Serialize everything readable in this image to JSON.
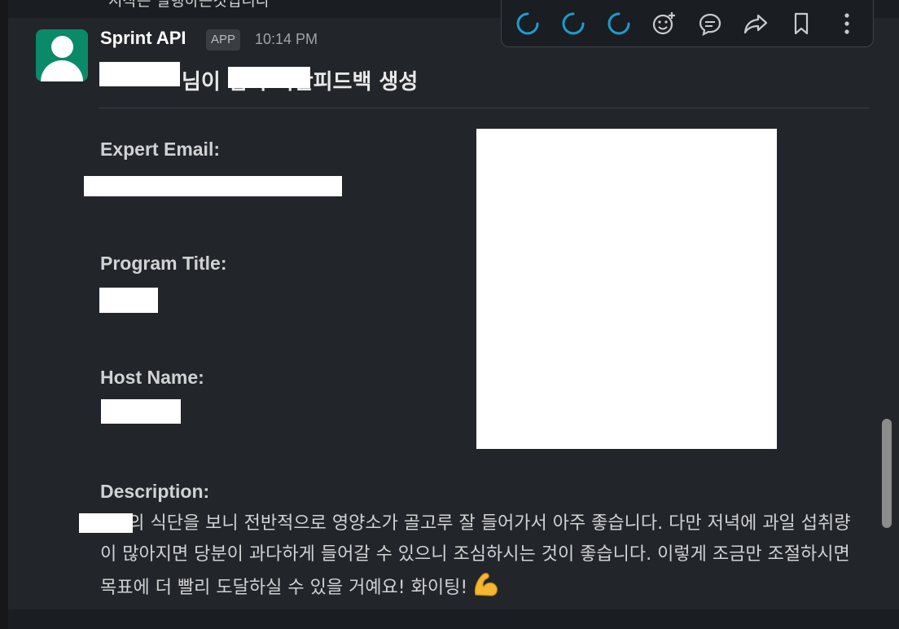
{
  "previous_message": {
    "text": "시작은 실행하는것입니다 ^^"
  },
  "message": {
    "sender": "Sprint API",
    "badge": "APP",
    "time": "10:14 PM",
    "headline": "님이 님의 식단피드백 생성",
    "fields": [
      {
        "label": "Expert Email:",
        "value": ""
      },
      {
        "label": "Program Title:",
        "value": ""
      },
      {
        "label": "Host Name:",
        "value": ""
      },
      {
        "label": "Description:",
        "value": ""
      }
    ],
    "description": "님의 식단을 보니 전반적으로 영양소가 골고루 잘 들어가서 아주 좋습니다. 다만 저녁에 과일 섭취량이 많아지면 당분이 과다하게 들어갈 수 있으니 조심하시는 것이 좋습니다. 이렇게 조금만 조절하시면 목표에 더 빨리 도달하실 수 있을 거예요! 화이팅!",
    "emoji": "flexed-biceps-icon"
  },
  "toolbar": {
    "icons": [
      "loading-icon",
      "loading-icon",
      "loading-icon",
      "add-reaction-icon",
      "reply-in-thread-icon",
      "share-icon",
      "bookmark-icon",
      "more-actions-icon"
    ]
  },
  "colors": {
    "background": "#222529",
    "link": "#1d9bd1",
    "avatar": "#0b8a6a",
    "spinner": "#1d9bd1"
  }
}
